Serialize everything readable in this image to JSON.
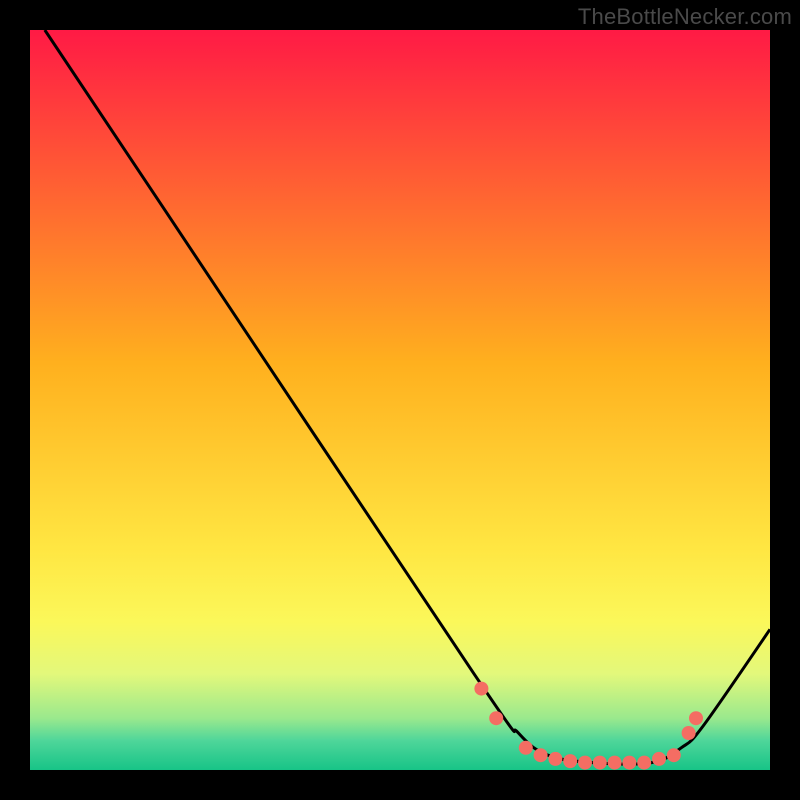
{
  "attribution": "TheBottleNecker.com",
  "chart_data": {
    "type": "line",
    "title": "",
    "xlabel": "",
    "ylabel": "",
    "xlim": [
      0,
      100
    ],
    "ylim": [
      0,
      100
    ],
    "gradient_stops": [
      {
        "pct": 0,
        "color": "#ff1a45"
      },
      {
        "pct": 45,
        "color": "#ffb01e"
      },
      {
        "pct": 70,
        "color": "#ffe642"
      },
      {
        "pct": 80,
        "color": "#fbf85a"
      },
      {
        "pct": 87,
        "color": "#e3f87b"
      },
      {
        "pct": 93,
        "color": "#9ae98d"
      },
      {
        "pct": 96,
        "color": "#4fd69a"
      },
      {
        "pct": 100,
        "color": "#17c487"
      }
    ],
    "series": [
      {
        "name": "bottleneck-curve",
        "type": "line",
        "points": [
          {
            "x": 2,
            "y": 100
          },
          {
            "x": 18,
            "y": 76
          },
          {
            "x": 60,
            "y": 13
          },
          {
            "x": 66,
            "y": 5
          },
          {
            "x": 70,
            "y": 2
          },
          {
            "x": 76,
            "y": 1
          },
          {
            "x": 84,
            "y": 1
          },
          {
            "x": 88,
            "y": 3
          },
          {
            "x": 91,
            "y": 6
          },
          {
            "x": 100,
            "y": 19
          }
        ]
      },
      {
        "name": "sample-dots",
        "type": "scatter",
        "color": "#f46d63",
        "points": [
          {
            "x": 61,
            "y": 11
          },
          {
            "x": 63,
            "y": 7
          },
          {
            "x": 67,
            "y": 3
          },
          {
            "x": 69,
            "y": 2
          },
          {
            "x": 71,
            "y": 1.5
          },
          {
            "x": 73,
            "y": 1.2
          },
          {
            "x": 75,
            "y": 1
          },
          {
            "x": 77,
            "y": 1
          },
          {
            "x": 79,
            "y": 1
          },
          {
            "x": 81,
            "y": 1
          },
          {
            "x": 83,
            "y": 1
          },
          {
            "x": 85,
            "y": 1.5
          },
          {
            "x": 87,
            "y": 2
          },
          {
            "x": 89,
            "y": 5
          },
          {
            "x": 90,
            "y": 7
          }
        ]
      }
    ]
  }
}
